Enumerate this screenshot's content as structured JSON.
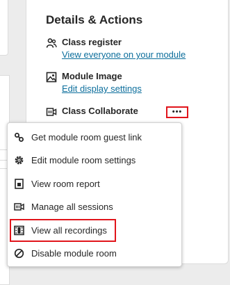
{
  "panel": {
    "title": "Details & Actions",
    "details": [
      {
        "icon": "users-icon",
        "title": "Class register",
        "link": "View everyone on your module"
      },
      {
        "icon": "image-icon",
        "title": "Module Image",
        "link": "Edit display settings"
      },
      {
        "icon": "collaborate-icon",
        "title": "Class Collaborate"
      }
    ],
    "more_button": {
      "icon": "more-options-icon",
      "glyph": "•••"
    }
  },
  "menu": {
    "items": [
      {
        "icon": "link-icon",
        "label": "Get module room guest link"
      },
      {
        "icon": "settings-gear-icon",
        "label": "Edit module room settings"
      },
      {
        "icon": "report-icon",
        "label": "View room report"
      },
      {
        "icon": "sessions-icon",
        "label": "Manage all sessions"
      },
      {
        "icon": "film-icon",
        "label": "View all recordings",
        "highlighted": true
      },
      {
        "icon": "disable-icon",
        "label": "Disable module room"
      }
    ]
  },
  "colors": {
    "link": "#0c6e9c",
    "highlight": "#e1141b",
    "text": "#262626",
    "background": "#ececec"
  }
}
